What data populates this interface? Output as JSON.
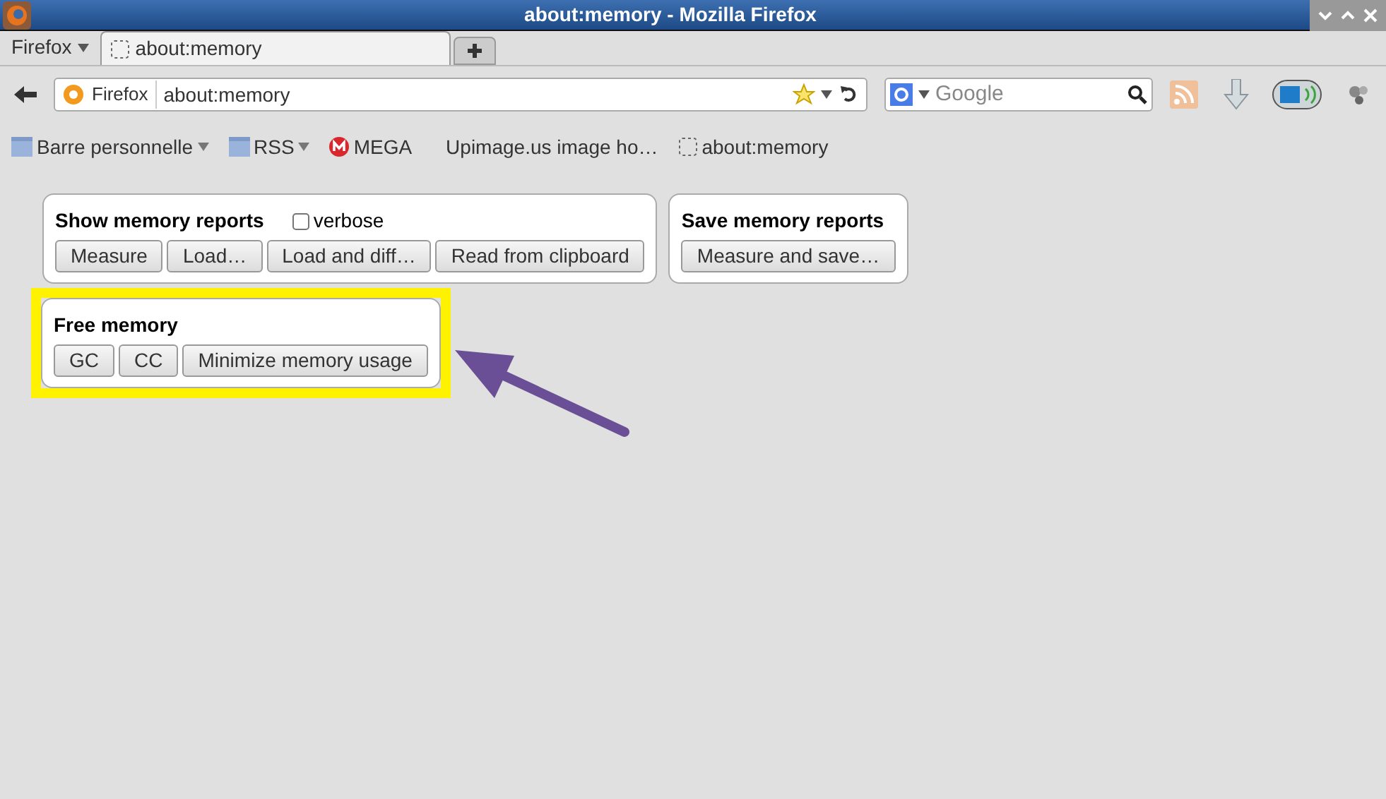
{
  "window": {
    "title": "about:memory - Mozilla Firefox"
  },
  "menu_button": "Firefox",
  "tabs": [
    {
      "label": "about:memory",
      "selected": true
    }
  ],
  "nav": {
    "identity": "Firefox",
    "url": "about:memory",
    "search_placeholder": "Google"
  },
  "bookmarks": [
    {
      "label": "Barre personnelle",
      "kind": "folder"
    },
    {
      "label": "RSS",
      "kind": "folder"
    },
    {
      "label": "MEGA",
      "kind": "mega"
    },
    {
      "label": "Upimage.us image ho…",
      "kind": "plain"
    },
    {
      "label": "about:memory",
      "kind": "page"
    }
  ],
  "sections": [
    {
      "title": "Show memory reports",
      "checkbox": {
        "label": "verbose",
        "checked": false
      },
      "buttons": [
        "Measure",
        "Load…",
        "Load and diff…",
        "Read from clipboard"
      ],
      "highlighted": false
    },
    {
      "title": "Save memory reports",
      "buttons": [
        "Measure and save…"
      ],
      "highlighted": false
    },
    {
      "title": "Free memory",
      "buttons": [
        "GC",
        "CC",
        "Minimize memory usage"
      ],
      "highlighted": true
    }
  ]
}
